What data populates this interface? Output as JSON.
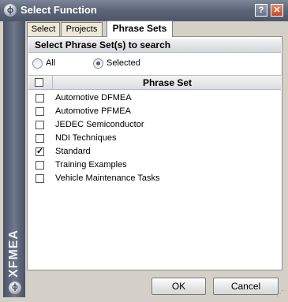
{
  "window": {
    "title": "Select Function",
    "title_icon": "xfmea-logo-icon",
    "help_label": "?",
    "close_label": "✕"
  },
  "sidebar": {
    "brand": "XFMEA"
  },
  "tabs": [
    {
      "label": "Select",
      "active": false
    },
    {
      "label": "Projects",
      "active": false
    },
    {
      "label": "Phrase Sets",
      "active": true
    }
  ],
  "section": {
    "title": "Select Phrase Set(s) to search"
  },
  "filter": {
    "options": [
      {
        "label": "All",
        "selected": false
      },
      {
        "label": "Selected",
        "selected": true
      }
    ]
  },
  "grid": {
    "header": "Phrase Set",
    "rows": [
      {
        "label": "Automotive DFMEA",
        "checked": false
      },
      {
        "label": "Automotive PFMEA",
        "checked": false
      },
      {
        "label": "JEDEC Semiconductor",
        "checked": false
      },
      {
        "label": "NDI Techniques",
        "checked": false
      },
      {
        "label": "Standard",
        "checked": true
      },
      {
        "label": "Training Examples",
        "checked": false
      },
      {
        "label": "Vehicle Maintenance Tasks",
        "checked": false
      }
    ]
  },
  "buttons": {
    "ok": "OK",
    "cancel": "Cancel"
  },
  "colors": {
    "titlebar": "#5e6779",
    "close_button": "#c24a26",
    "sidebar": "#5b6477"
  }
}
